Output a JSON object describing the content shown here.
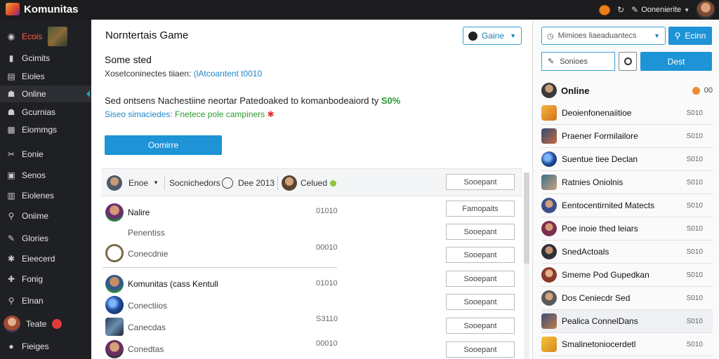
{
  "topbar": {
    "title": "Komunitas",
    "username": "Oonenierite",
    "colors": {
      "bar": "#1c1c1e",
      "accent": "#1e93d6"
    }
  },
  "sidebar": {
    "items": [
      {
        "label": "Ecois",
        "icon": "gamepad-icon",
        "color": "red"
      },
      {
        "label": "Gcimits",
        "icon": "book-icon"
      },
      {
        "label": "Eioles",
        "icon": "doc-icon"
      },
      {
        "label": "Online",
        "icon": "users-icon",
        "active": true
      },
      {
        "label": "Gcurnias",
        "icon": "users-icon"
      },
      {
        "label": "Eiommgs",
        "icon": "calendar-icon"
      },
      {
        "label": "Eonie",
        "icon": "tools-icon"
      },
      {
        "label": "Senos",
        "icon": "list-icon"
      },
      {
        "label": "Eiolenes",
        "icon": "grid-icon"
      },
      {
        "label": "Oniime",
        "icon": "search-icon"
      },
      {
        "label": "Glories",
        "icon": "pen-icon"
      },
      {
        "label": "Eieecerd",
        "icon": "gear-icon"
      },
      {
        "label": "Fonig",
        "icon": "puzzle-icon"
      },
      {
        "label": "Elnan",
        "icon": "search-icon"
      },
      {
        "label": "Teate",
        "icon": "avatar"
      },
      {
        "label": "Fieiges",
        "icon": "user-icon"
      }
    ]
  },
  "main": {
    "title": "Norntertais Game",
    "game_select": "Gaine",
    "section_title": "Some sted",
    "section_sub_prefix": "Xosetconinectes tiiaen: ",
    "section_sub_link": "(lAtcoantent t0010",
    "desc": "Sed ontsens Nachestiine neortar Patedoaked to komanbodeaiord ty ",
    "desc_pct": "S0%",
    "desc2_lead": "Siseo simaciedes: ",
    "desc2_text": "Fnetece pole campiners",
    "desc2_mark": "✱",
    "primary_btn": "Oomirre",
    "filter": {
      "name": "Enoe",
      "label": "Socnichedors",
      "date": "Dee 2013",
      "status": "Celued"
    },
    "outline_btn": "Sooepant",
    "rows": [
      {
        "name": "Nalire",
        "num": "01010"
      },
      {
        "name": "Penentiss",
        "num": ""
      },
      {
        "name": "Conecdnie",
        "num": "00010"
      },
      {
        "name": "Komunitas (cass Kentull",
        "num": "01010"
      },
      {
        "name": "Conectiios",
        "num": ""
      },
      {
        "name": "Canecdas",
        "num": "S3110"
      },
      {
        "name": "Conedtas",
        "num": "00010"
      }
    ],
    "row_buttons": [
      "Sooepant",
      "Famopaits",
      "Sooepant",
      "Sooepant",
      "Sooepant",
      "Sooepant",
      "Sooepant",
      "Sooepant"
    ]
  },
  "right": {
    "search_placeholder": "Mimioes liaeaduantecs",
    "search_btn": "Ecinn",
    "input_placeholder": "Sonioes",
    "dest_btn": "Dest",
    "online_label": "Online",
    "online_count": "00",
    "friends": [
      {
        "name": "Deoienfonenaiitioe",
        "num": "S010"
      },
      {
        "name": "Praener Formilailore",
        "num": "S010"
      },
      {
        "name": "Suentue tiee Declan",
        "num": "S010"
      },
      {
        "name": "Ratnies Oniolnis",
        "num": "S010"
      },
      {
        "name": "Eentocentirnited Matects",
        "num": "S010"
      },
      {
        "name": "Poe inoie thed leiars",
        "num": "S010"
      },
      {
        "name": "SnedActoals",
        "num": "S010"
      },
      {
        "name": "Smeme Pod Gupedkan",
        "num": "S010"
      },
      {
        "name": "Dos Ceniecdr Sed",
        "num": "S010"
      },
      {
        "name": "Pealica ConnelDans",
        "num": "S010"
      },
      {
        "name": "Smalinetoniocerdetl",
        "num": "S010"
      }
    ]
  }
}
